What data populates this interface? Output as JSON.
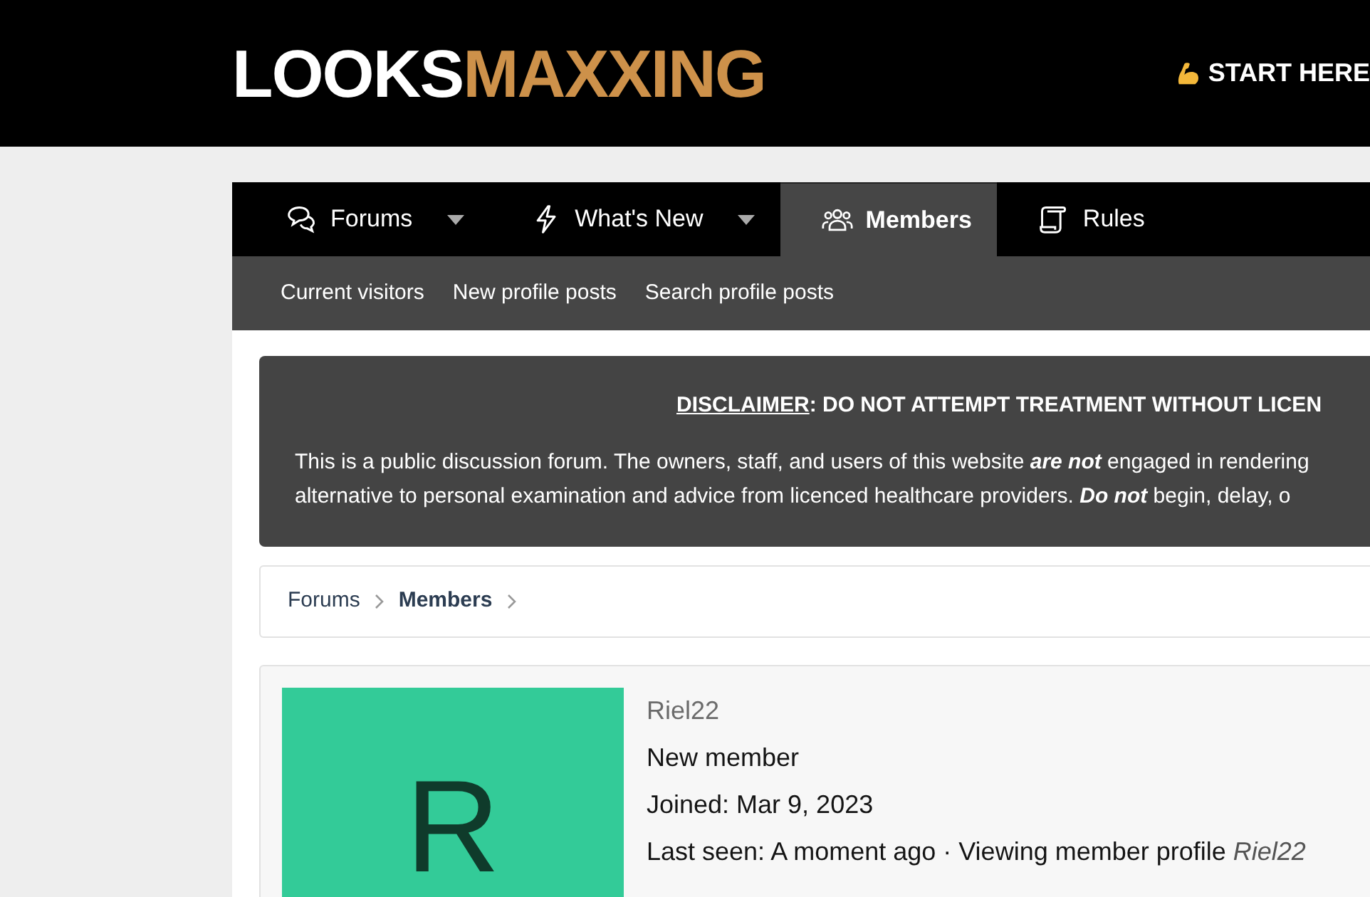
{
  "header": {
    "logo": {
      "first": "LOOKS",
      "second": "MAXXING"
    },
    "start_link": "START HERE"
  },
  "nav": {
    "tabs": [
      {
        "label": "Forums",
        "dropdown": true,
        "selected": false
      },
      {
        "label": "What's New",
        "dropdown": true,
        "selected": false
      },
      {
        "label": "Members",
        "dropdown": false,
        "selected": true
      },
      {
        "label": "Rules",
        "dropdown": false,
        "selected": false
      }
    ],
    "sub_links": [
      "Current visitors",
      "New profile posts",
      "Search profile posts"
    ]
  },
  "disclaimer": {
    "label": "DISCLAIMER",
    "heading": ": DO NOT ATTEMPT TREATMENT WITHOUT LICEN",
    "lines": [
      "This is a public discussion forum. The owners, staff, and users of this website **are not** engaged in rendering",
      "alternative to personal examination and advice from licenced healthcare providers. **Do not** begin, delay, o"
    ]
  },
  "breadcrumb": [
    {
      "label": "Forums",
      "current": false
    },
    {
      "label": "Members",
      "current": true
    }
  ],
  "member": {
    "avatar_letter": "R",
    "username": "Riel22",
    "title": "New member",
    "joined": "Joined: Mar 9, 2023",
    "last_seen": "Last seen: A moment ago · Viewing member profile",
    "last_seen_target": "Riel22"
  }
}
